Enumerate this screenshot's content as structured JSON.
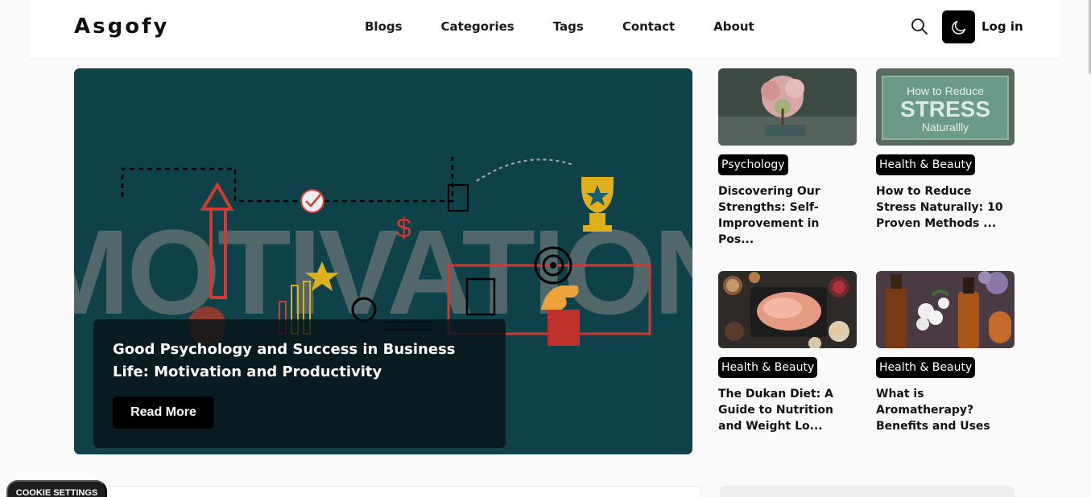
{
  "brand": "Asgofy",
  "nav": [
    {
      "label": "Blogs"
    },
    {
      "label": "Categories"
    },
    {
      "label": "Tags"
    },
    {
      "label": "Contact"
    },
    {
      "label": "About"
    }
  ],
  "header": {
    "login_label": "Log in",
    "search_icon": "search-icon",
    "theme_icon": "moon-icon"
  },
  "hero": {
    "image_word": "MOTIVATION",
    "title": "Good Psychology and Success in Business Life: Motivation and Productivity",
    "button_label": "Read More"
  },
  "cards": [
    {
      "category": "Psychology",
      "title": "Discovering Our Strengths: Self-Improvement in Pos..."
    },
    {
      "category": "Health & Beauty",
      "title": "How to Reduce Stress Naturally: 10 Proven Methods ...",
      "image_text": [
        "How to Reduce",
        "STRESS",
        "Naturallly"
      ]
    },
    {
      "category": "Health & Beauty",
      "title": "The Dukan Diet: A Guide to Nutrition and Weight Lo..."
    },
    {
      "category": "Health & Beauty",
      "title": "What is Aromatherapy? Benefits and Uses"
    }
  ],
  "cookie_label": "COOKIE SETTINGS",
  "colors": {
    "hero_bg": "#0f4148",
    "badge_bg": "#000000",
    "accent": "#000000"
  }
}
